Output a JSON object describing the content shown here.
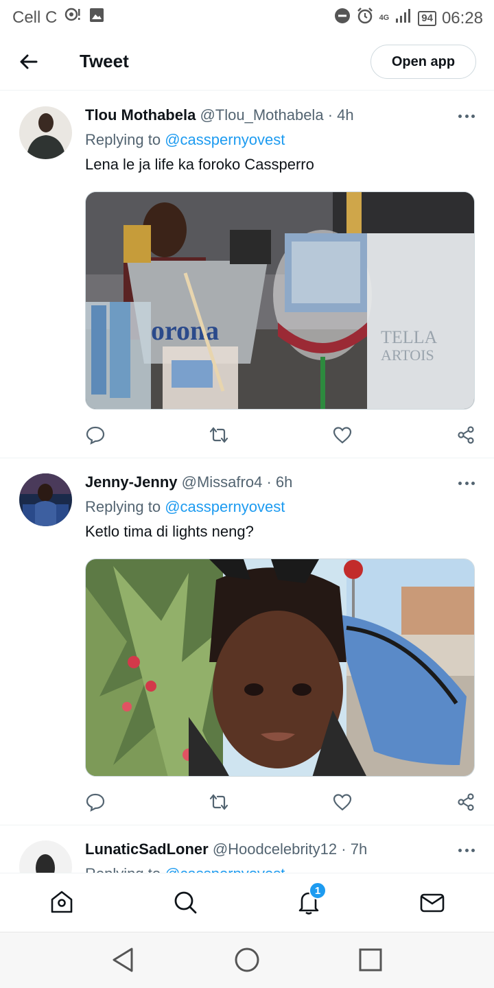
{
  "status_bar": {
    "carrier": "Cell C",
    "network": "4G",
    "battery": "94",
    "time": "06:28",
    "icons": [
      "notification-icon",
      "image-icon",
      "dnd-icon",
      "alarm-icon",
      "signal-icon",
      "battery-icon"
    ]
  },
  "header": {
    "title": "Tweet",
    "open_app_label": "Open app",
    "back_icon": "back-arrow-icon"
  },
  "tweets": [
    {
      "name": "Tlou Mothabela",
      "handle": "@Tlou_Mothabela",
      "time": "4h",
      "replying_label": "Replying to",
      "replying_to": "@casspernyovest",
      "text": "Lena le ja life ka foroko Cassperro",
      "media": "photo-drinks-with-banknotes"
    },
    {
      "name": "Jenny-Jenny",
      "handle": "@Missafro4",
      "time": "6h",
      "replying_label": "Replying to",
      "replying_to": "@casspernyovest",
      "text": "Ketlo tima di lights neng?",
      "media": "photo-child-with-backpack"
    },
    {
      "name": "LunaticSadLoner",
      "handle": "@Hoodcelebrity12",
      "time": "7h",
      "replying_label": "Replying to",
      "replying_to": "@casspernyovest",
      "text": ""
    }
  ],
  "separator": "·",
  "bottom_nav": {
    "notification_count": "1",
    "items": [
      "home-icon",
      "search-icon",
      "notifications-icon",
      "messages-icon"
    ]
  },
  "system_nav": [
    "back-triangle-icon",
    "home-circle-icon",
    "recents-square-icon"
  ],
  "colors": {
    "accent": "#1d9bf0",
    "text": "#0f1419",
    "secondary": "#536471",
    "border": "#eff3f4"
  }
}
